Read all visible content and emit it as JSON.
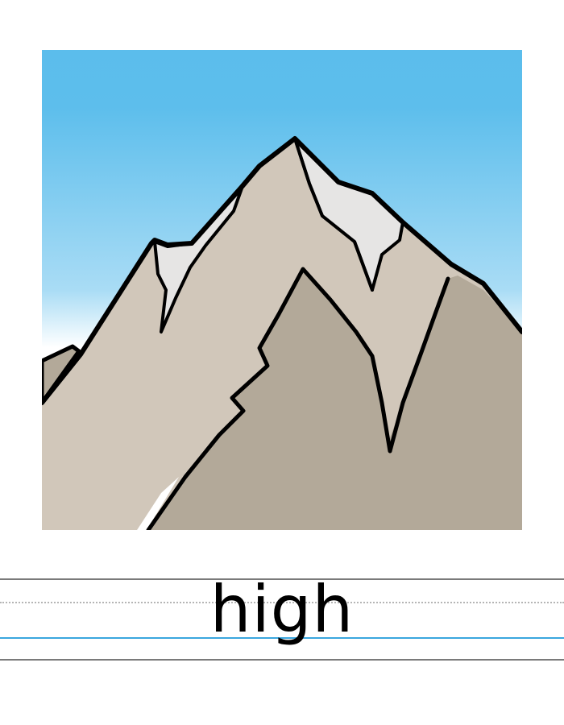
{
  "card": {
    "word": "high",
    "image_subject": "mountain-icon",
    "colors": {
      "sky_top": "#5bbdec",
      "sky_bottom": "#ffffff",
      "rock_light": "#d1c7ba",
      "rock_dark": "#b3a999",
      "snow": "#e6e5e4",
      "outline": "#000000",
      "guide_line": "#7a7a7a",
      "baseline": "#3aa6de"
    }
  }
}
